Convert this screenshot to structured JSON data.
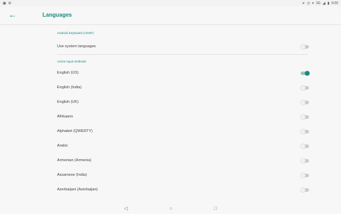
{
  "status_bar": {
    "left_icons": [
      "image-icon",
      "settings-icon"
    ],
    "right_icons": [
      "bluetooth-icon",
      "alarm-icon",
      "wifi-icon",
      "signal-icon",
      "battery-icon"
    ],
    "network": "3G",
    "time": "9:00"
  },
  "toolbar": {
    "title": "Languages"
  },
  "sections": [
    {
      "header": "Android Keyboard (AOSP)",
      "rows": [
        {
          "label": "Use system languages",
          "on": false
        }
      ]
    },
    {
      "header": "Active input methods",
      "rows": [
        {
          "label": "English (US)",
          "on": true
        },
        {
          "label": "English (India)",
          "on": false
        },
        {
          "label": "English (UK)",
          "on": false
        },
        {
          "label": "Afrikaans",
          "on": false
        },
        {
          "label": "Alphabet (QWERTY)",
          "on": false
        },
        {
          "label": "Arabic",
          "on": false
        },
        {
          "label": "Armenian (Armenia)",
          "on": false
        },
        {
          "label": "Assamese (India)",
          "on": false
        },
        {
          "label": "Azerbaijani (Azerbaijan)",
          "on": false
        }
      ]
    }
  ],
  "colors": {
    "accent": "#1a8a80",
    "background": "#f7f7f7"
  }
}
